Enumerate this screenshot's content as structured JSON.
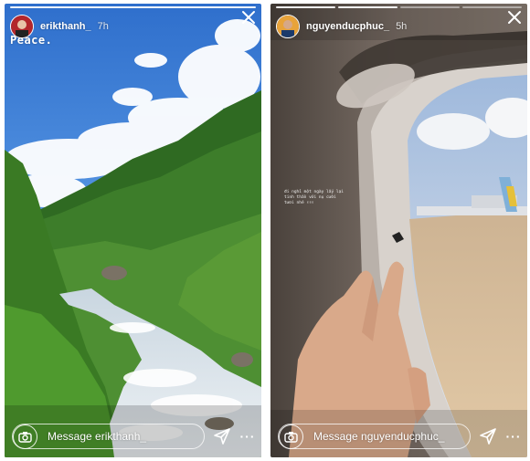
{
  "stories": [
    {
      "username": "erikthanh_",
      "time": "7h",
      "caption": "Peace.",
      "reply_placeholder": "Message erikthanh_",
      "more_label": "···"
    },
    {
      "username": "nguyenducphuc_",
      "time": "5h",
      "sticker_text": "đi nghỉ một ngày lấy lại tinh thần với nụ cười tươi nhé ✌✌✌",
      "reply_placeholder": "Message nguyenducphuc_",
      "more_label": "···"
    }
  ],
  "colors": {
    "sky_left": "#3d7fd6",
    "forest": "#2f6a22",
    "river": "#dfe7ee",
    "cabin": "#6e6259",
    "window_sky": "#cfdaea",
    "tarmac": "#c9a784"
  }
}
